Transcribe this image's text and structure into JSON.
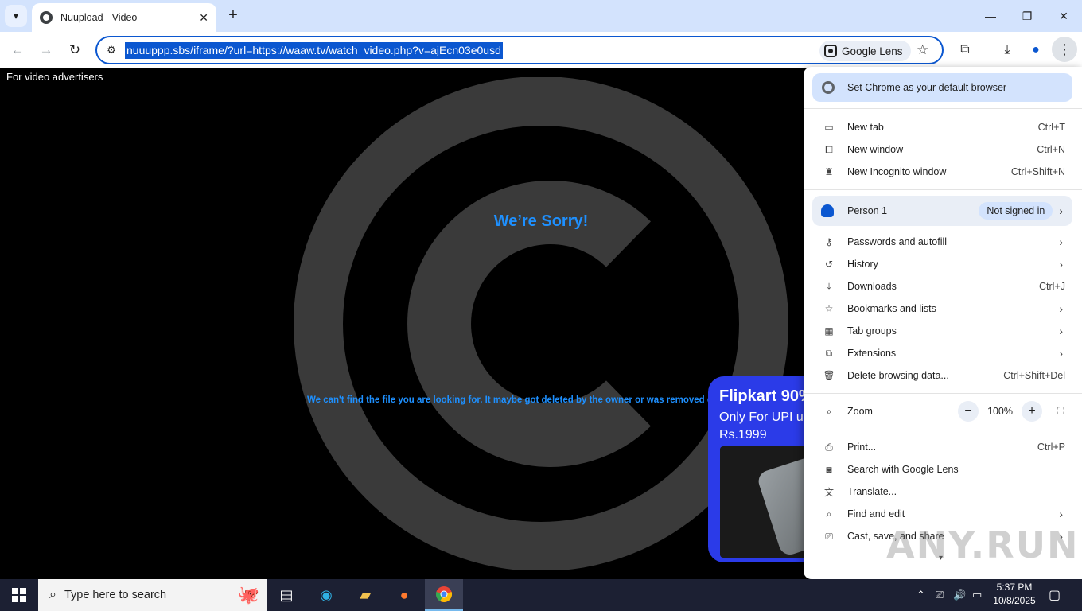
{
  "tab": {
    "title": "Nuupload - Video",
    "close": "✕"
  },
  "toolbar": {
    "url": "nuuuppp.sbs/iframe/?url=https://waaw.tv/watch_video.php?v=ajEcn03e0usd",
    "lens_label": "Google Lens"
  },
  "page": {
    "advertisers": "For video advertisers",
    "sorry": "We’re Sorry!",
    "not_found": "We can't find the file you are looking for. It maybe got deleted by the owner or was removed due a co",
    "ad_heading": "Flipkart 90%",
    "ad_line1": "Only For UPI u",
    "ad_line2": "Rs.1999"
  },
  "menu": {
    "default_browser": "Set Chrome as your default browser",
    "new_tab": {
      "label": "New tab",
      "shortcut": "Ctrl+T"
    },
    "new_window": {
      "label": "New window",
      "shortcut": "Ctrl+N"
    },
    "incognito": {
      "label": "New Incognito window",
      "shortcut": "Ctrl+Shift+N"
    },
    "person": {
      "label": "Person 1",
      "status": "Not signed in"
    },
    "passwords": "Passwords and autofill",
    "history": "History",
    "downloads": {
      "label": "Downloads",
      "shortcut": "Ctrl+J"
    },
    "bookmarks": "Bookmarks and lists",
    "tab_groups": "Tab groups",
    "extensions": "Extensions",
    "delete_data": {
      "label": "Delete browsing data...",
      "shortcut": "Ctrl+Shift+Del"
    },
    "zoom": {
      "label": "Zoom",
      "value": "100%"
    },
    "print": {
      "label": "Print...",
      "shortcut": "Ctrl+P"
    },
    "search_lens": "Search with Google Lens",
    "translate": "Translate...",
    "find_edit": "Find and edit",
    "cast": "Cast, save, and share"
  },
  "watermark": "ANY.RUN",
  "taskbar": {
    "search_placeholder": "Type here to search",
    "time": "5:37 PM",
    "date": "10/8/2025"
  },
  "colors": {
    "accent": "#0b57d0",
    "sorry_text": "#1e90ff",
    "ad_bg": "#2b3be8",
    "taskbar": "#1c2033"
  }
}
